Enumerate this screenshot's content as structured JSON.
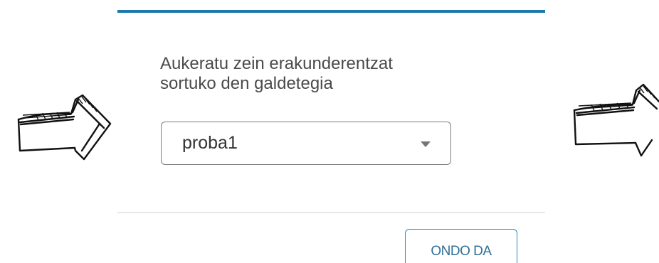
{
  "dialog": {
    "prompt": "Aukeratu zein erakunderentzat\nsortuko den galdetegia",
    "organization_select": {
      "selected_value": "proba1"
    },
    "ok_button_label": "ONDO DA",
    "accent_color": "#1f78ad"
  },
  "annotations": {
    "left_arrow": "hand-drawn-right-arrow",
    "right_arrow": "hand-drawn-right-arrow"
  }
}
